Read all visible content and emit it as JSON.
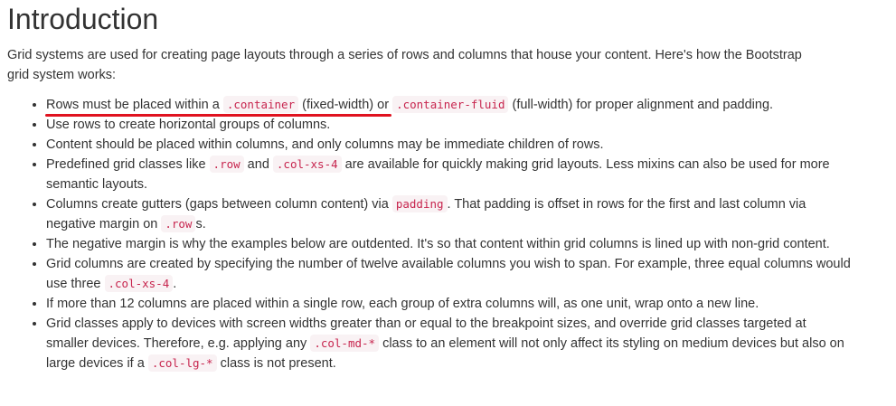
{
  "heading": "Introduction",
  "intro": "Grid systems are used for creating page layouts through a series of rows and columns that house your content. Here's how the Bootstrap grid system works:",
  "items": [
    {
      "t0": "Rows must be placed within a ",
      "c0": ".container",
      "t1": " (fixed-width) or ",
      "c1": ".container-fluid",
      "t2": " (full-width) for proper alignment and padding."
    },
    {
      "t0": "Use rows to create horizontal groups of columns."
    },
    {
      "t0": "Content should be placed within columns, and only columns may be immediate children of rows."
    },
    {
      "t0": "Predefined grid classes like ",
      "c0": ".row",
      "t1": " and ",
      "c1": ".col-xs-4",
      "t2": " are available for quickly making grid layouts. Less mixins can also be used for more semantic layouts."
    },
    {
      "t0": "Columns create gutters (gaps between column content) via ",
      "c0": "padding",
      "t1": ". That padding is offset in rows for the first and last column via negative margin on ",
      "c1": ".row",
      "t2": "s."
    },
    {
      "t0": "The negative margin is why the examples below are outdented. It's so that content within grid columns is lined up with non-grid content."
    },
    {
      "t0": "Grid columns are created by specifying the number of twelve available columns you wish to span. For example, three equal columns would use three ",
      "c0": ".col-xs-4",
      "t1": "."
    },
    {
      "t0": "If more than 12 columns are placed within a single row, each group of extra columns will, as one unit, wrap onto a new line."
    },
    {
      "t0": "Grid classes apply to devices with screen widths greater than or equal to the breakpoint sizes, and override grid classes targeted at smaller devices. Therefore, e.g. applying any ",
      "c0": ".col-md-*",
      "t1": " class to an element will not only affect its styling on medium devices but also on large devices if a ",
      "c1": ".col-lg-*",
      "t2": " class is not present."
    }
  ],
  "annotation_color": "#e0121f"
}
